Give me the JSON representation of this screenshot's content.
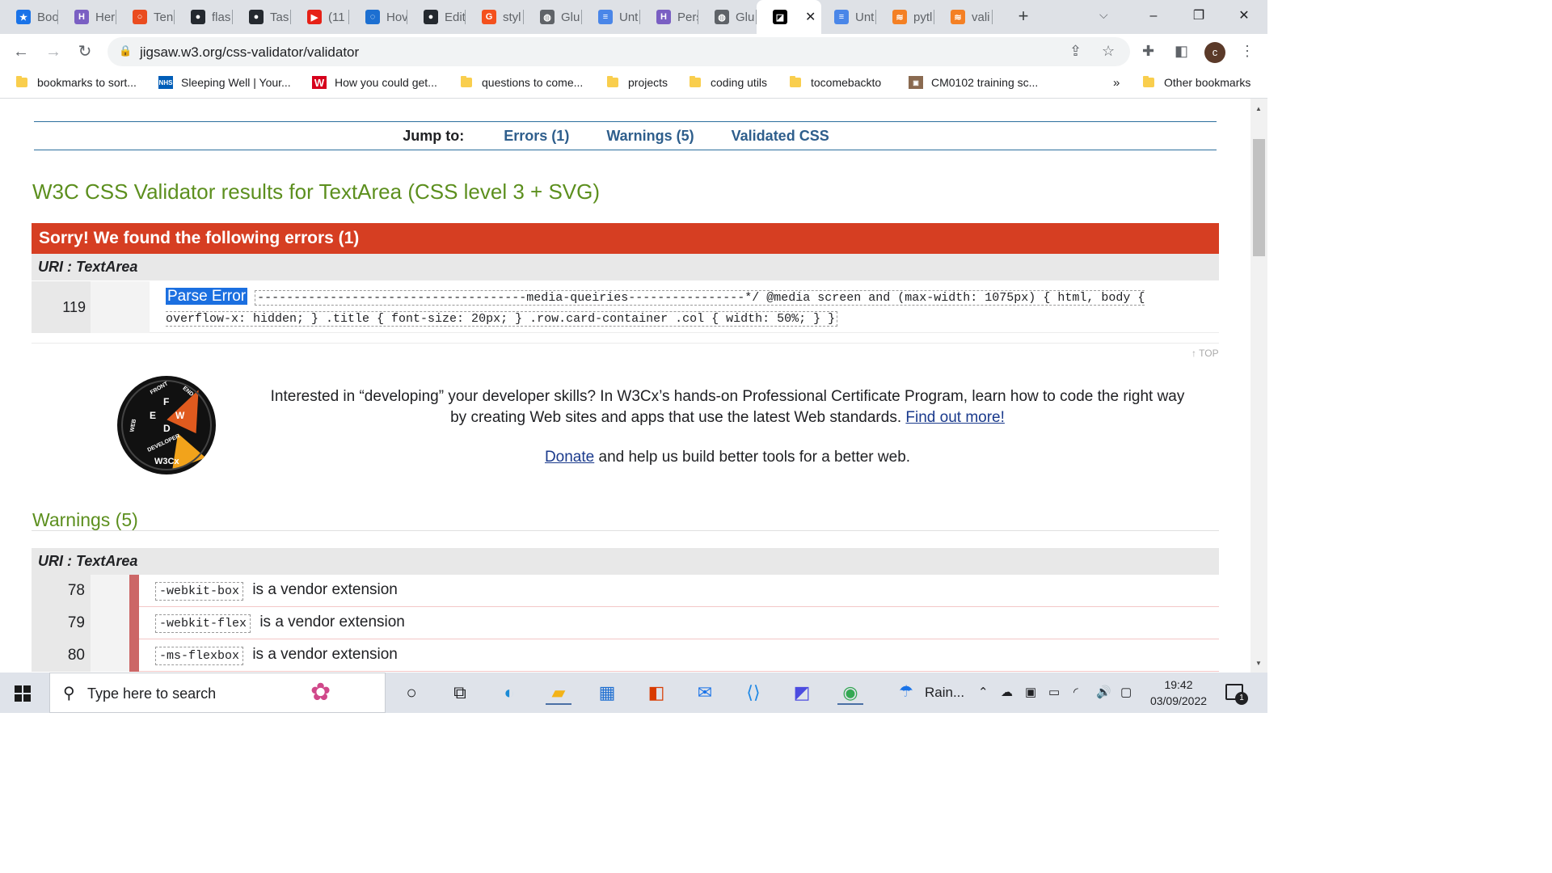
{
  "tabs": [
    {
      "label": "Boo",
      "color": "#1a73e8",
      "glyph": "★"
    },
    {
      "label": "Her",
      "color": "#7a5fc3",
      "glyph": "H"
    },
    {
      "label": "Ten",
      "color": "#ea4c1f",
      "glyph": "○"
    },
    {
      "label": "flas",
      "color": "#24292f",
      "glyph": "●"
    },
    {
      "label": "Tas",
      "color": "#24292f",
      "glyph": "●"
    },
    {
      "label": "(11",
      "color": "#e62117",
      "glyph": "▶"
    },
    {
      "label": "Hov",
      "color": "#1c6fd1",
      "glyph": "◌"
    },
    {
      "label": "Edit",
      "color": "#24292f",
      "glyph": "●"
    },
    {
      "label": "styl",
      "color": "#f4511e",
      "glyph": "G"
    },
    {
      "label": "Glu",
      "color": "#5f6368",
      "glyph": "◍"
    },
    {
      "label": "Unt",
      "color": "#4a86e8",
      "glyph": "≡"
    },
    {
      "label": "Pers",
      "color": "#7a5fc3",
      "glyph": "H"
    },
    {
      "label": "Glu",
      "color": "#5f6368",
      "glyph": "◍"
    },
    {
      "label": "",
      "color": "#000000",
      "glyph": "◪",
      "active": true
    },
    {
      "label": "Unt",
      "color": "#4a86e8",
      "glyph": "≡"
    },
    {
      "label": "pytl",
      "color": "#f48024",
      "glyph": "≋"
    },
    {
      "label": "vali",
      "color": "#f48024",
      "glyph": "≋"
    }
  ],
  "toolbar": {
    "url": "jigsaw.w3.org/css-validator/validator",
    "profile_initial": "c"
  },
  "bookmarks": [
    {
      "label": "bookmarks to sort...",
      "type": "folder"
    },
    {
      "label": "Sleeping Well | Your...",
      "type": "nhs"
    },
    {
      "label": "How you could get...",
      "type": "w"
    },
    {
      "label": "questions to come...",
      "type": "folder"
    },
    {
      "label": "projects",
      "type": "folder"
    },
    {
      "label": "coding utils",
      "type": "folder"
    },
    {
      "label": "tocomebackto",
      "type": "folder"
    },
    {
      "label": "CM0102 training sc...",
      "type": "img"
    }
  ],
  "bookmarks_more": "»",
  "other_bookmarks": "Other bookmarks",
  "jump": {
    "label": "Jump to:",
    "errors": "Errors (1)",
    "warnings": "Warnings (5)",
    "validated": "Validated CSS"
  },
  "title": "W3C CSS Validator results for TextArea (CSS level 3 + SVG)",
  "errors_header": "Sorry! We found the following errors (1)",
  "uri_label": "URI : TextArea",
  "error": {
    "line": "119",
    "badge": "Parse Error",
    "text": "-------------------------------------media-queiries----------------*/ @media screen and (max-width: 1075px) { html, body { overflow-x: hidden; } .title { font-size: 20px; } .row.card-container .col { width: 50%; } }"
  },
  "top_link": "↑ TOP",
  "badge": {
    "letters": [
      "F",
      "E",
      "W",
      "D"
    ],
    "word1": "FRONT",
    "word2": "END",
    "word3": "WEB",
    "word4": "DEVELOPER",
    "brand": "W3Cx"
  },
  "promo": {
    "text": "Interested in “developing” your developer skills? In W3Cx’s hands-on Professional Certificate Program, learn how to code the right way by creating Web sites and apps that use the latest Web standards.",
    "link": "Find out more!"
  },
  "donate": {
    "link": "Donate",
    "text": " and help us build better tools for a better web."
  },
  "warnings_title": "Warnings (5)",
  "warnings": [
    {
      "line": "78",
      "code": "-webkit-box",
      "text": "is a vendor extension"
    },
    {
      "line": "79",
      "code": "-webkit-flex",
      "text": "is a vendor extension"
    },
    {
      "line": "80",
      "code": "-ms-flexbox",
      "text": "is a vendor extension"
    }
  ],
  "taskbar": {
    "search_placeholder": "Type here to search",
    "weather": "Rain...",
    "time": "19:42",
    "date": "03/09/2022",
    "notifications": "1"
  }
}
